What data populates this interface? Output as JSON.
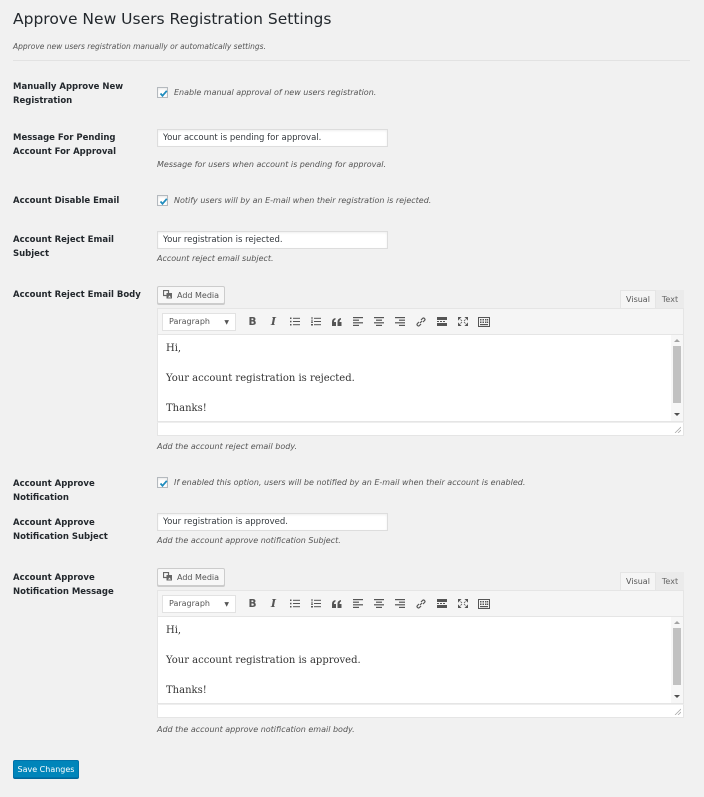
{
  "page": {
    "title": "Approve New Users Registration Settings",
    "description": "Approve new users registration manually or automatically settings."
  },
  "fields": {
    "manual_approve": {
      "label": "Manually Approve New Registration",
      "checked": true,
      "checkbox_label": "Enable manual approval of new users registration."
    },
    "pending_message": {
      "label": "Message For Pending Account For Approval",
      "value": "Your account is pending for approval.",
      "description": "Message for users when account is pending for approval."
    },
    "disable_email": {
      "label": "Account Disable Email",
      "checked": true,
      "checkbox_label": "Notify users will by an E-mail when their registration is rejected."
    },
    "reject_subject": {
      "label": "Account Reject Email Subject",
      "value": "Your registration is rejected.",
      "description": "Account reject email subject."
    },
    "reject_body": {
      "label": "Account Reject Email Body",
      "lines": [
        "Hi,",
        "Your account registration is rejected.",
        "Thanks!"
      ],
      "description": "Add the account reject email body."
    },
    "approve_notification": {
      "label": "Account Approve Notification",
      "checked": true,
      "checkbox_label": "If enabled this option, users will be notified by an E-mail when their account is enabled."
    },
    "approve_subject": {
      "label": "Account Approve Notification Subject",
      "value": "Your registration is approved.",
      "description": "Add the account approve notification Subject."
    },
    "approve_message": {
      "label": "Account Approve Notification Message",
      "lines": [
        "Hi,",
        "Your account registration is approved.",
        "Thanks!"
      ],
      "description": "Add the account approve notification email body."
    }
  },
  "editor": {
    "add_media_label": "Add Media",
    "tab_visual": "Visual",
    "tab_text": "Text",
    "format_select": "Paragraph",
    "toolbar_icons": [
      "bold-icon",
      "italic-icon",
      "bullet-list-icon",
      "numbered-list-icon",
      "blockquote-icon",
      "align-left-icon",
      "align-center-icon",
      "align-right-icon",
      "link-icon",
      "read-more-icon",
      "fullscreen-icon",
      "toolbar-toggle-icon"
    ],
    "bold_glyph": "B",
    "italic_glyph": "I",
    "blockquote_glyph": "“"
  },
  "colors": {
    "primary_button": "#0085ba",
    "check": "#1e8cbe",
    "background": "#f1f1f1"
  },
  "actions": {
    "save_label": "Save Changes"
  }
}
